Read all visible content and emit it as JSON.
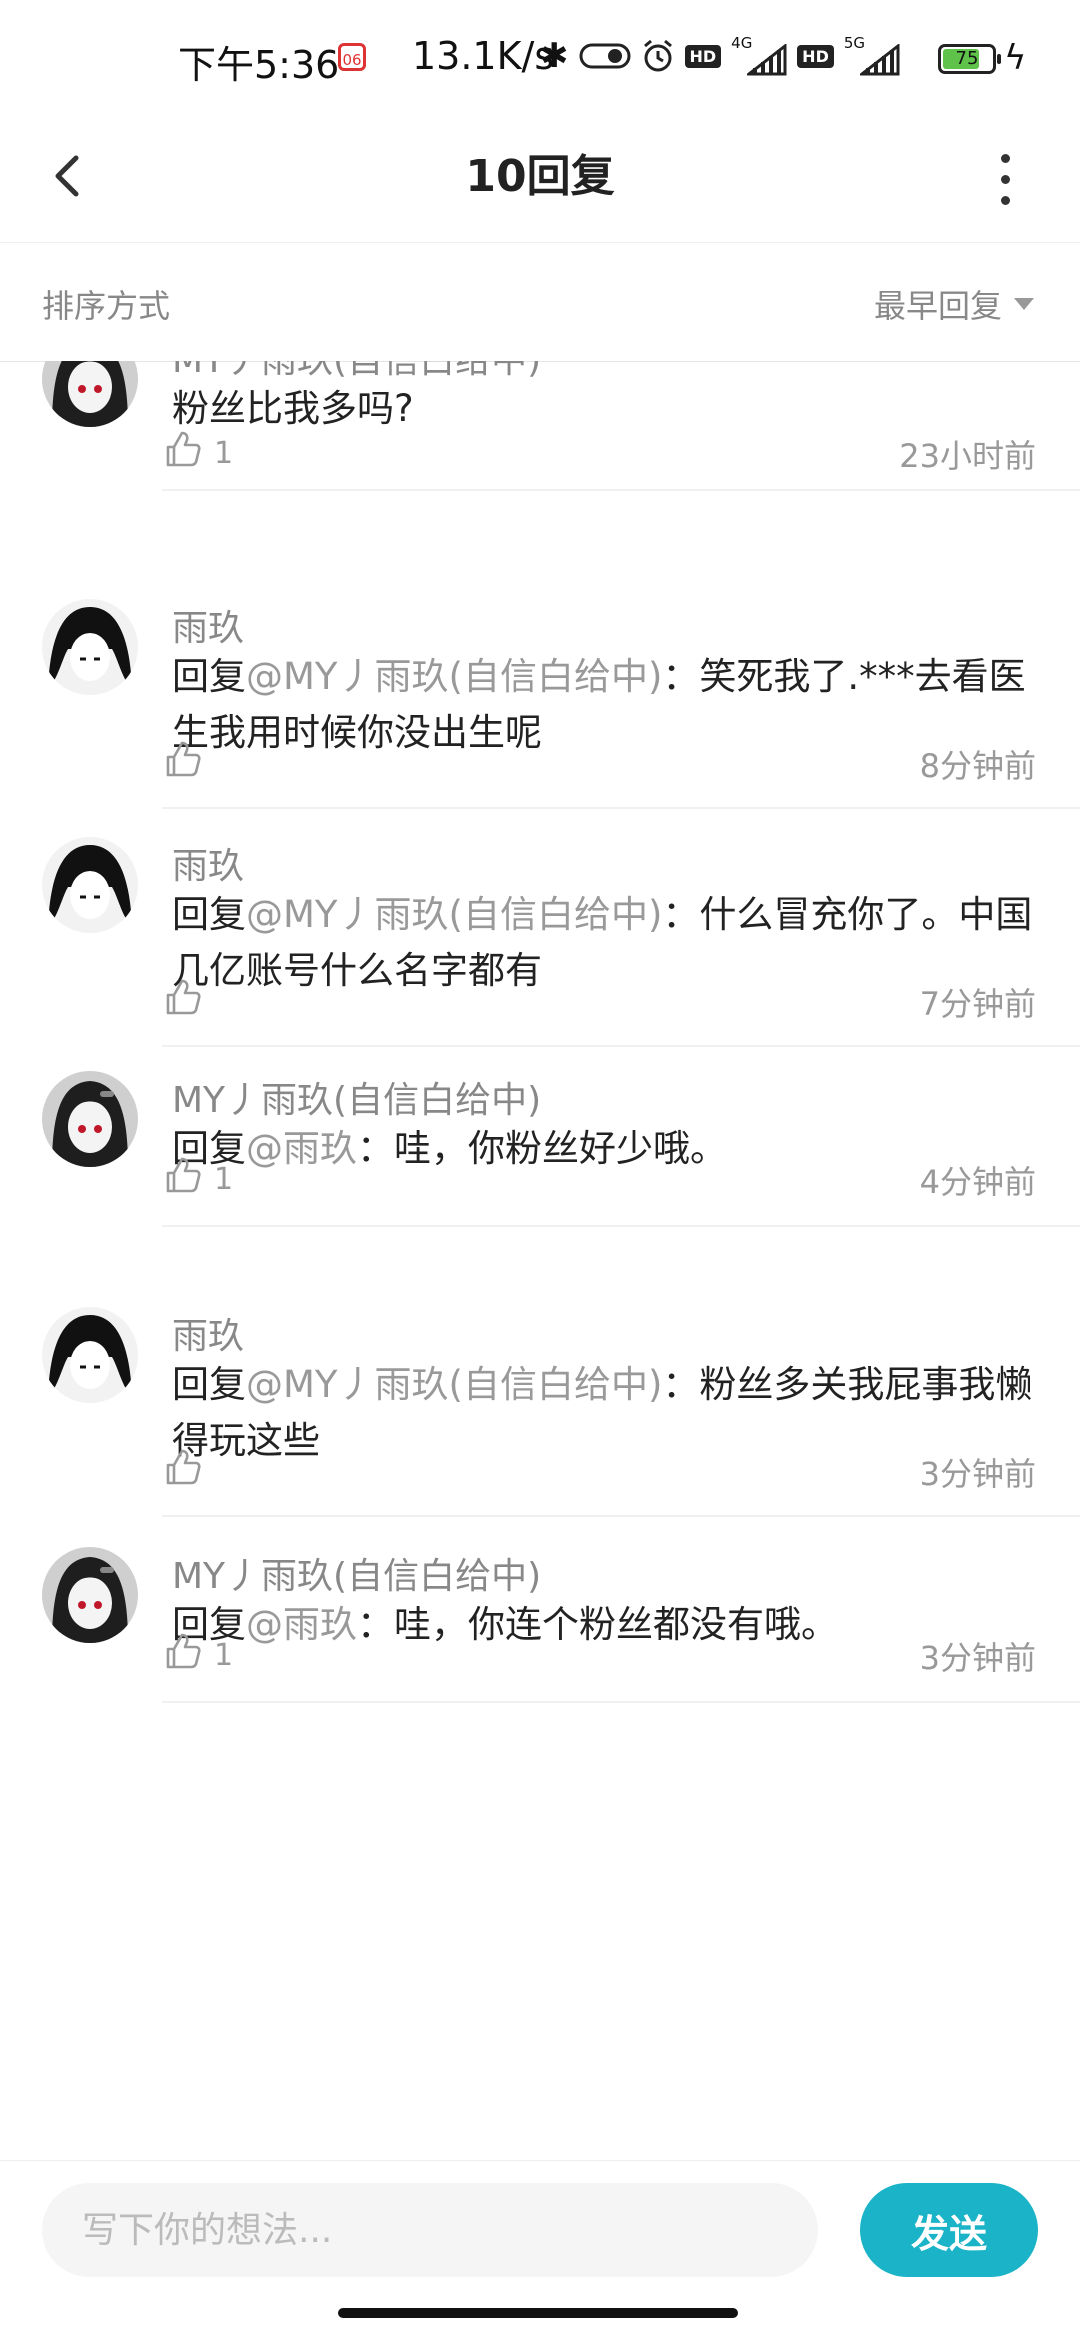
{
  "status_bar": {
    "time": "下午5:36",
    "badge": "06",
    "speed": "13.1K/s",
    "net1": "4G",
    "net2": "5G",
    "battery": "75",
    "battery_level": 0.75
  },
  "header": {
    "title": "10回复"
  },
  "sort": {
    "label": "排序方式",
    "value": "最早回复"
  },
  "replies": [
    {
      "user": "MY丿雨玖(自信白给中)",
      "text": "粉丝比我多吗?",
      "at": "",
      "likes": "1",
      "time": "23小时前",
      "avatar": "red-eye"
    },
    {
      "user": "雨玖",
      "reply_prefix": "回复",
      "at": "@MY丿雨玖(自信白给中)",
      "text": "：笑死我了.***去看医生我用时候你没出生呢",
      "likes": "",
      "time": "8分钟前",
      "avatar": "bw"
    },
    {
      "user": "雨玖",
      "reply_prefix": "回复",
      "at": "@MY丿雨玖(自信白给中)",
      "text": "：什么冒充你了。中国几亿账号什么名字都有",
      "likes": "",
      "time": "7分钟前",
      "avatar": "bw"
    },
    {
      "user": "MY丿雨玖(自信白给中)",
      "reply_prefix": "回复",
      "at": "@雨玖",
      "text": "：哇，你粉丝好少哦。",
      "likes": "1",
      "time": "4分钟前",
      "avatar": "red-eye"
    },
    {
      "user": "雨玖",
      "reply_prefix": "回复",
      "at": "@MY丿雨玖(自信白给中)",
      "text": "：粉丝多关我屁事我懒得玩这些",
      "likes": "",
      "time": "3分钟前",
      "avatar": "bw"
    },
    {
      "user": "MY丿雨玖(自信白给中)",
      "reply_prefix": "回复",
      "at": "@雨玖",
      "text": "：哇，你连个粉丝都没有哦。",
      "likes": "1",
      "time": "3分钟前",
      "avatar": "red-eye"
    }
  ],
  "composer": {
    "placeholder": "写下你的想法...",
    "send_label": "发送"
  },
  "colors": {
    "accent": "#1bb3c7",
    "muted": "#999999"
  }
}
